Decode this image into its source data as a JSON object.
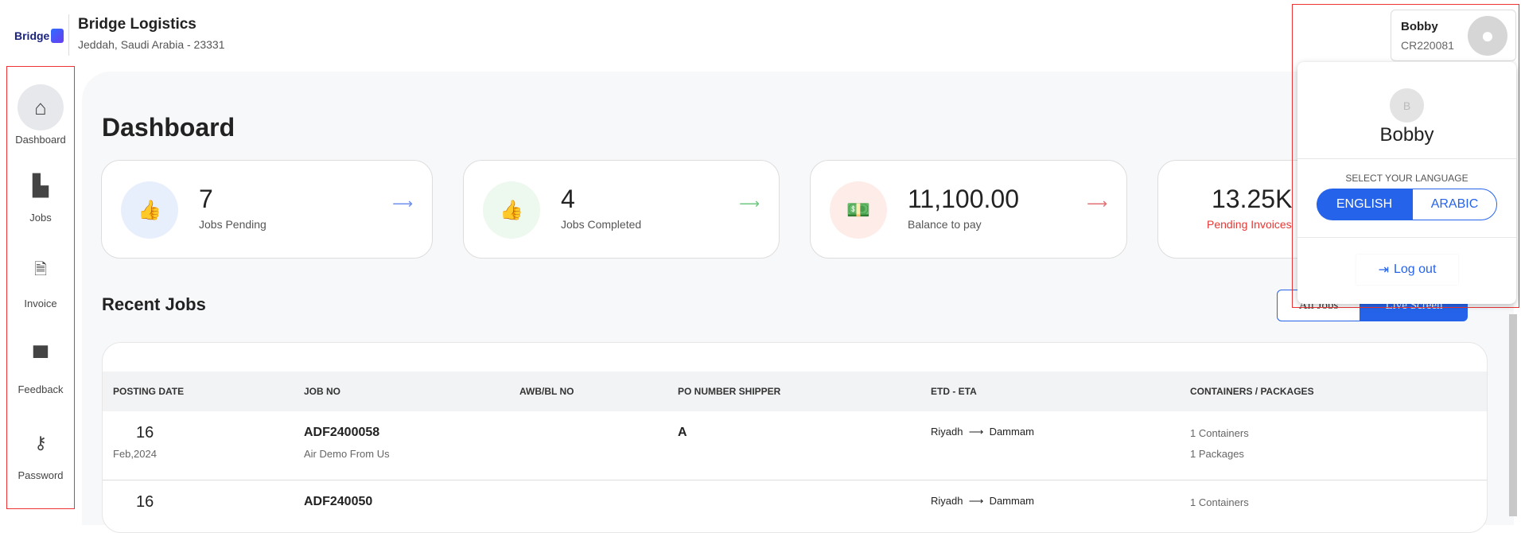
{
  "header": {
    "logo_text": "Bridge",
    "company": "Bridge Logistics",
    "address": "Jeddah, Saudi Arabia - 23331"
  },
  "sidebar": {
    "items": [
      {
        "label": "Dashboard",
        "icon": "home-icon"
      },
      {
        "label": "Jobs",
        "icon": "scroll-icon"
      },
      {
        "label": "Invoice",
        "icon": "invoice-icon"
      },
      {
        "label": "Feedback",
        "icon": "comment-icon"
      },
      {
        "label": "Password",
        "icon": "key-icon"
      }
    ]
  },
  "main": {
    "title": "Dashboard",
    "cards": [
      {
        "value": "7",
        "label": "Jobs Pending",
        "color": "#2a6ee8",
        "bg": "#e8effc"
      },
      {
        "value": "4",
        "label": "Jobs Completed",
        "color": "#2ebd59",
        "bg": "#edf8ef"
      },
      {
        "value": "11,100.00",
        "label": "Balance to pay",
        "color": "#d32f2f",
        "bg": "#fdece8"
      },
      {
        "value": "13.25K",
        "label": "Pending Invoices",
        "color": "#e53935"
      }
    ],
    "recent_title": "Recent Jobs",
    "all_jobs": "All Jobs",
    "live_screen": "Live Screen",
    "table": {
      "headers": [
        "POSTING DATE",
        "JOB NO",
        "AWB/BL NO",
        "PO NUMBER SHIPPER",
        "ETD - ETA",
        "CONTAINERS / PACKAGES"
      ],
      "rows": [
        {
          "day": "16",
          "month": "Feb,2024",
          "job": "ADF2400058",
          "desc": "Air Demo From Us",
          "awb": "",
          "po": "A",
          "from": "Riyadh",
          "to": "Dammam",
          "containers": "1 Containers",
          "packages": "1 Packages"
        },
        {
          "day": "16",
          "month": "",
          "job": "ADF240050",
          "desc": "",
          "awb": "",
          "po": "",
          "from": "Riyadh",
          "to": "Dammam",
          "containers": "1 Containers",
          "packages": ""
        }
      ]
    }
  },
  "profile": {
    "name": "Bobby",
    "code": "CR220081",
    "initial": "B"
  },
  "dropdown": {
    "name": "Bobby",
    "lang_title": "SELECT YOUR LANGUAGE",
    "english": "ENGLISH",
    "arabic": "ARABIC",
    "logout": "Log out",
    "accent": "#2563eb"
  }
}
